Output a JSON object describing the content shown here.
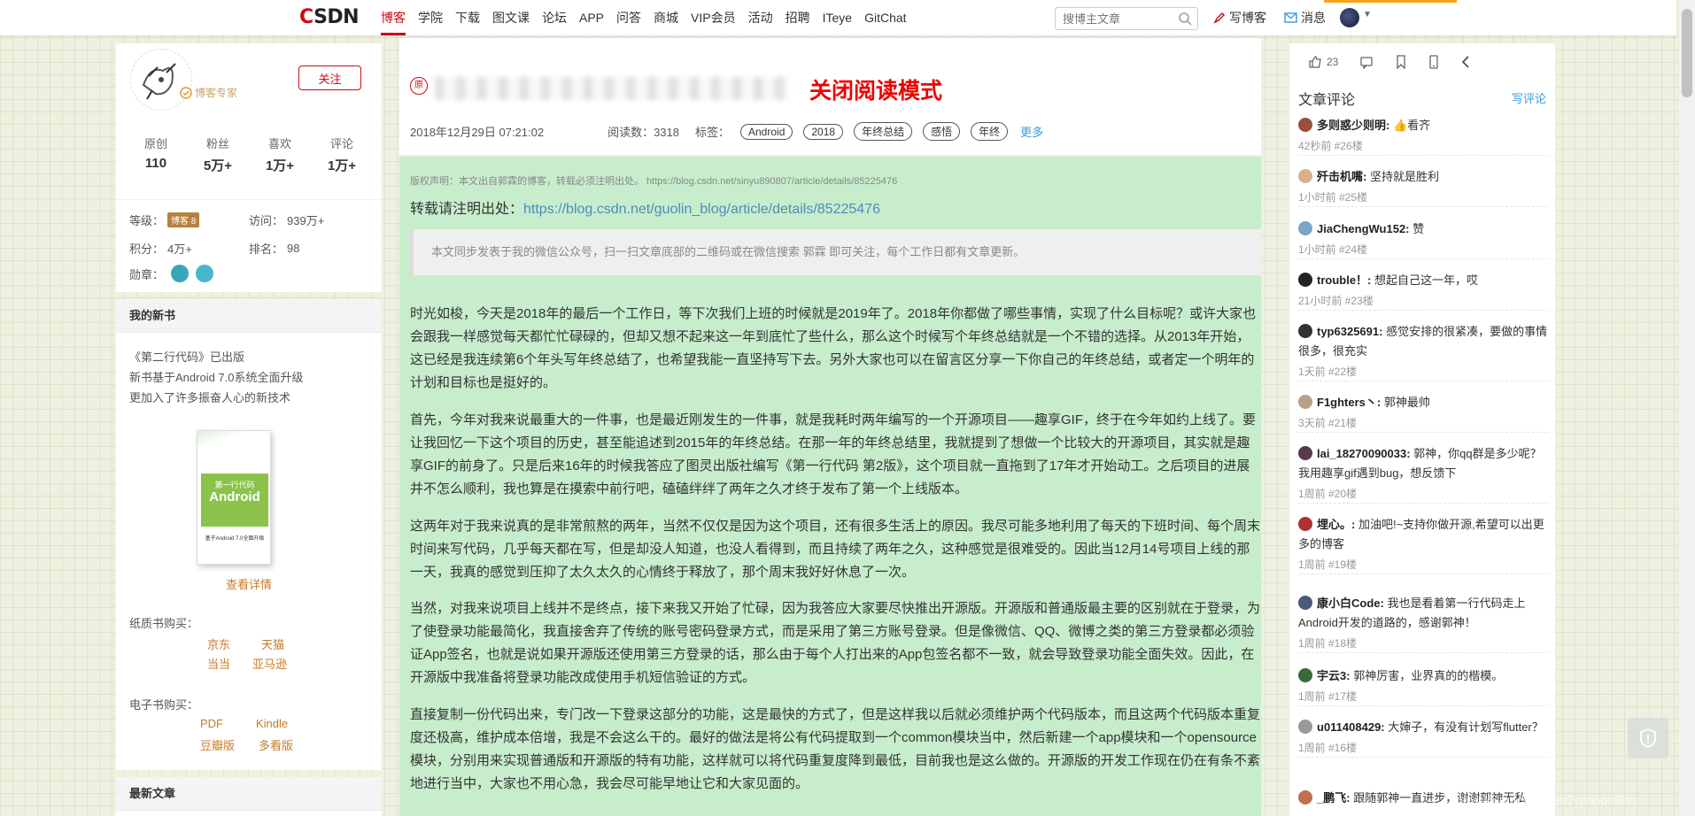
{
  "nav": {
    "logo": "CSDN",
    "items": [
      "博客",
      "学院",
      "下载",
      "图文课",
      "论坛",
      "APP",
      "问答",
      "商城",
      "VIP会员",
      "活动",
      "招聘",
      "ITeye",
      "GitChat"
    ],
    "search_placeholder": "搜博主文章",
    "write_label": "写博客",
    "message_label": "消息",
    "colors": {
      "brand": "#ca0c16",
      "accent": "#f6a21b"
    }
  },
  "profile": {
    "expert_label": "博客专家",
    "follow_label": "关注",
    "stats": [
      {
        "label": "原创",
        "value": "110"
      },
      {
        "label": "粉丝",
        "value": "5万+"
      },
      {
        "label": "喜欢",
        "value": "1万+"
      },
      {
        "label": "评论",
        "value": "1万+"
      }
    ],
    "level_label": "等级：",
    "level_badge": "博客 8",
    "visits_label": "访问：",
    "visits_value": "939万+",
    "points_label": "积分：",
    "points_value": "4万+",
    "rank_label": "排名：",
    "rank_value": "98",
    "medals_label": "勋章："
  },
  "new_book": {
    "header": "我的新书",
    "lines": [
      "《第二行代码》已出版",
      "新书基于Android 7.0系统全面升级",
      "更加入了许多振奋人心的新技术"
    ],
    "cover_subtitle": "第一行代码",
    "cover_title": "Android",
    "cover_note": "基于Android 7.0全面升级",
    "view_detail": "查看详情",
    "paper_label": "纸质书购买：",
    "paper_links": [
      "京东",
      "天猫",
      "当当",
      "亚马逊"
    ],
    "ebook_label": "电子书购买：",
    "ebook_links": [
      "PDF",
      "Kindle",
      "豆瓣版",
      "多看版"
    ]
  },
  "latest": {
    "header": "最新文章"
  },
  "article": {
    "original_badge": "原",
    "reading_mode": "关闭阅读模式",
    "date": "2018年12月29日 07:21:02",
    "read_count": "阅读数：3318",
    "tags_label": "标签：",
    "tags": [
      "Android",
      "2018",
      "年终总结",
      "感悟",
      "年终"
    ],
    "more_label": "更多",
    "copyright": "版权声明：本文出自郭霖的博客，转载必须注明出处。 https://blog.csdn.net/sinyu890807/article/details/85225476",
    "repost_prefix": "转载请注明出处：",
    "repost_link": "https://blog.csdn.net/guolin_blog/article/details/85225476",
    "notice": "本文同步发表于我的微信公众号，扫一扫文章底部的二维码或在微信搜索 郭霖 即可关注，每个工作日都有文章更新。",
    "paragraphs": [
      "时光如梭，今天是2018年的最后一个工作日，等下次我们上班的时候就是2019年了。2018年你都做了哪些事情，实现了什么目标呢？或许大家也会跟我一样感觉每天都忙忙碌碌的，但却又想不起来这一年到底忙了些什么，那么这个时候写个年终总结就是一个不错的选择。从2013年开始，这已经是我连续第6个年头写年终总结了，也希望我能一直坚持写下去。另外大家也可以在留言区分享一下你自己的年终总结，或者定一个明年的计划和目标也是挺好的。",
      "首先，今年对我来说最重大的一件事，也是最近刚发生的一件事，就是我耗时两年编写的一个开源项目——趣享GIF，终于在今年如约上线了。要让我回忆一下这个项目的历史，甚至能追述到2015年的年终总结。在那一年的年终总结里，我就提到了想做一个比较大的开源项目，其实就是趣享GIF的前身了。只是后来16年的时候我答应了图灵出版社编写《第一行代码 第2版》，这个项目就一直拖到了17年才开始动工。之后项目的进展并不怎么顺利，我也算是在摸索中前行吧，磕磕绊绊了两年之久才终于发布了第一个上线版本。",
      "这两年对于我来说真的是非常煎熬的两年，当然不仅仅是因为这个项目，还有很多生活上的原因。我尽可能多地利用了每天的下班时间、每个周末时间来写代码，几乎每天都在写，但是却没人知道，也没人看得到，而且持续了两年之久，这种感觉是很难受的。因此当12月14号项目上线的那一天，我真的感觉到压抑了太久太久的心情终于释放了，那个周末我好好休息了一次。",
      "当然，对我来说项目上线并不是终点，接下来我又开始了忙碌，因为我答应大家要尽快推出开源版。开源版和普通版最主要的区别就在于登录，为了使登录功能最简化，我直接舍弃了传统的账号密码登录方式，而是采用了第三方账号登录。但是像微信、QQ、微博之类的第三方登录都必须验证App签名，也就是说如果开源版还使用第三方登录的话，那么由于每个人打出来的App包签名都不一致，就会导致登录功能全面失效。因此，在开源版中我准备将登录功能改成使用手机短信验证的方式。",
      "直接复制一份代码出来，专门改一下登录这部分的功能，这是最快的方式了，但是这样我以后就必须维护两个代码版本，而且这两个代码版本重复度还极高，维护成本倍增，我是不会这么干的。最好的做法是将公有代码提取到一个common模块当中，然后新建一个app模块和一个opensource模块，分别用来实现普通版和开源版的特有功能，这样就可以将代码重复度降到最低，目前我也是这么做的。开源版的开发工作现在仍在有条不紊地进行当中，大家也不用心急，我会尽可能早地让它和大家见面的。"
    ]
  },
  "toolbar": {
    "like_count": "23"
  },
  "comments": {
    "title": "文章评论",
    "write_label": "写评论",
    "items": [
      {
        "name": "多则惑少则明:",
        "text": "👍看齐",
        "meta": "42秒前 #26楼",
        "color": "#9b4e3a"
      },
      {
        "name": "歼击机嘴:",
        "text": "坚持就是胜利",
        "meta": "1小时前 #25楼",
        "color": "#d9b08c"
      },
      {
        "name": "JiaChengWu152:",
        "text": "赞",
        "meta": "1小时前 #24楼",
        "color": "#7aa4c8"
      },
      {
        "name": "trouble！:",
        "text": "想起自己这一年，哎",
        "meta": "21小时前 #23楼",
        "color": "#222222"
      },
      {
        "name": "typ6325691:",
        "text": "感觉安排的很紧凑，要做的事情很多，很充实",
        "meta": "1天前 #22楼",
        "color": "#333333"
      },
      {
        "name": "F1ghters丶:",
        "text": "郭神最帅",
        "meta": "3天前 #21楼",
        "color": "#b8a08a"
      },
      {
        "name": "lai_18270090033:",
        "text": "郭神，你qq群是多少呢？我用趣享gif遇到bug，想反馈下",
        "meta": "1周前 #20楼",
        "color": "#5a3a4a"
      },
      {
        "name": "埋心。:",
        "text": "加油吧!~支持你做开源,希望可以出更多的博客",
        "meta": "1周前 #19楼",
        "color": "#b03030"
      },
      {
        "name": "康小白Code:",
        "text": "我也是看着第一行代码走上Android开发的道路的，感谢郭神！",
        "meta": "1周前 #18楼",
        "color": "#4a5a7a"
      },
      {
        "name": "宇云3:",
        "text": "郭神厉害，业界真的的楷模。",
        "meta": "1周前 #17楼",
        "color": "#3a6a3a"
      },
      {
        "name": "u011408429:",
        "text": "大婶子，有没有计划写flutter？",
        "meta": "1周前 #16楼",
        "color": "#999999"
      },
      {
        "name": "_鹏飞:",
        "text": "跟随郭神一直进步，谢谢郭神无私",
        "meta": "",
        "color": "#c07050"
      }
    ]
  },
  "watermark": "https://blog.csdn.net/TyphoonSun"
}
